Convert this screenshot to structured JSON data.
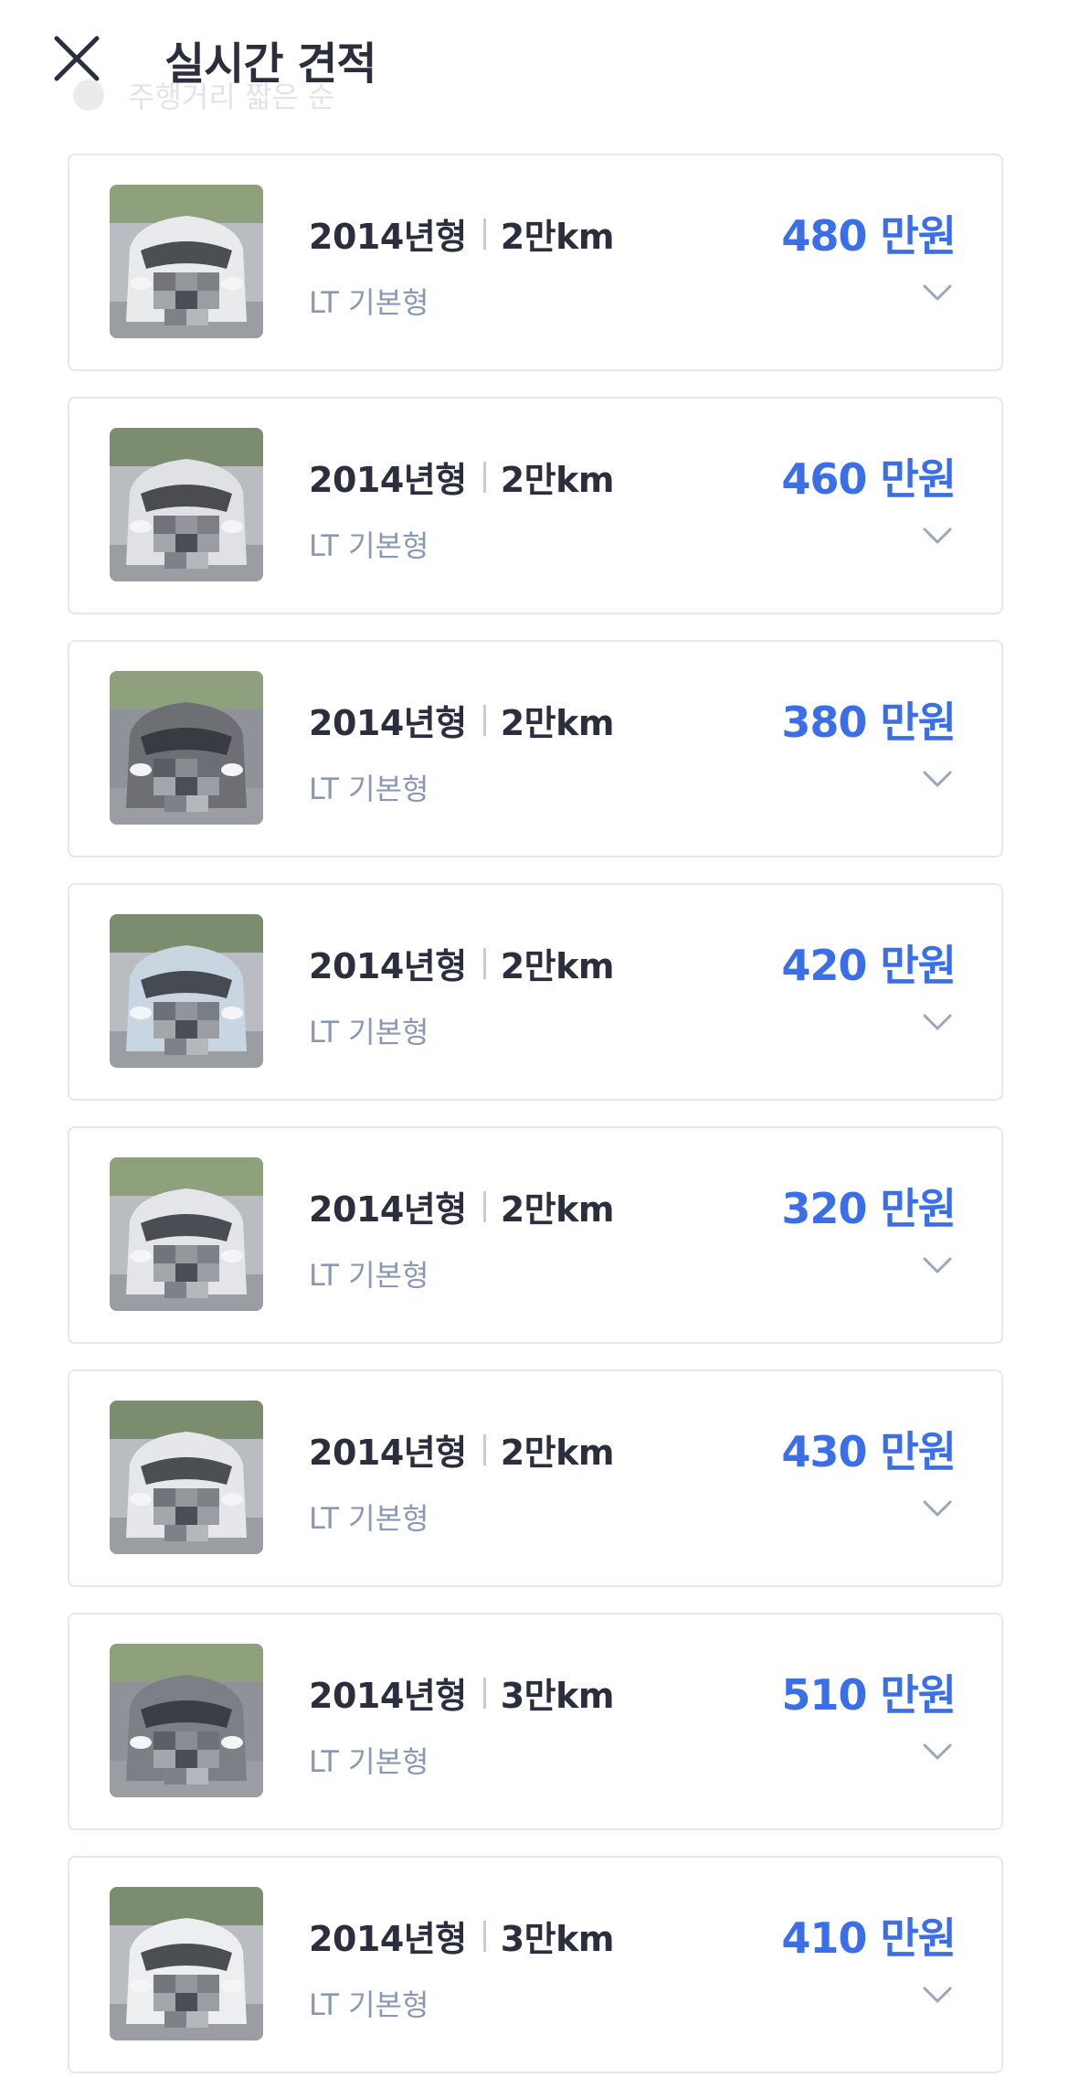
{
  "header": {
    "title": "실시간 견적",
    "close_icon": "close-icon"
  },
  "sort_hint": {
    "text": "주행거리 짧은 순",
    "icon": "info-icon"
  },
  "colors": {
    "price": "#3b6fe8",
    "text_primary": "#2b2f3d",
    "text_secondary": "#8a98b4",
    "card_border": "#e4e8f0"
  },
  "quotes": [
    {
      "year": "2014년형",
      "mileage": "2만km",
      "trim": "LT 기본형",
      "price": "480 만원",
      "car_color": "#e9eaec"
    },
    {
      "year": "2014년형",
      "mileage": "2만km",
      "trim": "LT 기본형",
      "price": "460 만원",
      "car_color": "#dfe1e4"
    },
    {
      "year": "2014년형",
      "mileage": "2만km",
      "trim": "LT 기본형",
      "price": "380 만원",
      "car_color": "#6d6f75"
    },
    {
      "year": "2014년형",
      "mileage": "2만km",
      "trim": "LT 기본형",
      "price": "420 만원",
      "car_color": "#c9d6e2"
    },
    {
      "year": "2014년형",
      "mileage": "2만km",
      "trim": "LT 기본형",
      "price": "320 만원",
      "car_color": "#e3e5e8"
    },
    {
      "year": "2014년형",
      "mileage": "2만km",
      "trim": "LT 기본형",
      "price": "430 만원",
      "car_color": "#e6e7ea"
    },
    {
      "year": "2014년형",
      "mileage": "3만km",
      "trim": "LT 기본형",
      "price": "510 만원",
      "car_color": "#7d7f86"
    },
    {
      "year": "2014년형",
      "mileage": "3만km",
      "trim": "LT 기본형",
      "price": "410 만원",
      "car_color": "#eceef0"
    }
  ]
}
